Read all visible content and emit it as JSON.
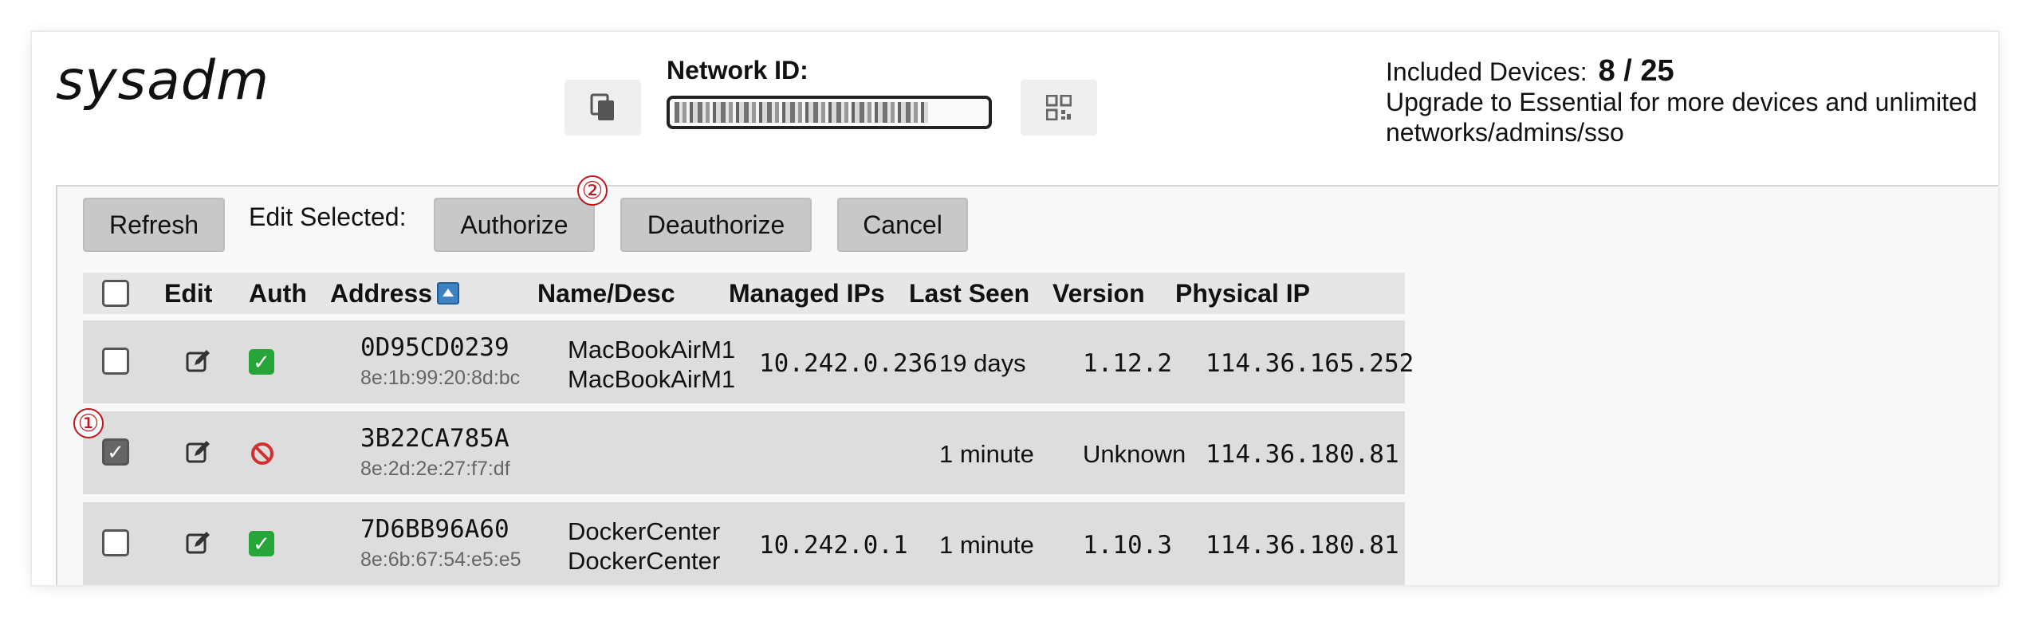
{
  "header": {
    "title": "sysadm",
    "network_id_label": "Network ID:",
    "included_label": "Included Devices:",
    "included_count": "8 / 25",
    "upgrade_text": "Upgrade to Essential for more devices and unlimited networks/admins/sso"
  },
  "toolbar": {
    "refresh": "Refresh",
    "edit_selected": "Edit Selected:",
    "authorize": "Authorize",
    "deauthorize": "Deauthorize",
    "cancel": "Cancel"
  },
  "markers": {
    "m1": "①",
    "m2": "②"
  },
  "table": {
    "columns": [
      "Edit",
      "Auth",
      "Address",
      "Name/Desc",
      "Managed IPs",
      "Last Seen",
      "Version",
      "Physical IP"
    ],
    "rows": [
      {
        "address": "0D95CD0239",
        "mac": "8e:1b:99:20:8d:bc",
        "name": "MacBookAirM1",
        "desc": "MacBookAirM1",
        "managed_ip": "10.242.0.236",
        "last_seen": "19 days",
        "version": "1.12.2",
        "physical_ip": "114.36.165.252",
        "auth": "authorized",
        "selected": false
      },
      {
        "address": "3B22CA785A",
        "mac": "8e:2d:2e:27:f7:df",
        "name": "",
        "desc": "",
        "managed_ip": "",
        "last_seen": "1 minute",
        "version": "Unknown",
        "physical_ip": "114.36.180.81",
        "auth": "unauthorized",
        "selected": true
      },
      {
        "address": "7D6BB96A60",
        "mac": "8e:6b:67:54:e5:e5",
        "name": "DockerCenter",
        "desc": "DockerCenter",
        "managed_ip": "10.242.0.1",
        "last_seen": "1 minute",
        "version": "1.10.3",
        "physical_ip": "114.36.180.81",
        "auth": "authorized",
        "selected": false
      }
    ]
  },
  "colors": {
    "auth_ok": "#27a53a",
    "auth_denied": "#d32f2f",
    "marker": "#c0161d"
  }
}
